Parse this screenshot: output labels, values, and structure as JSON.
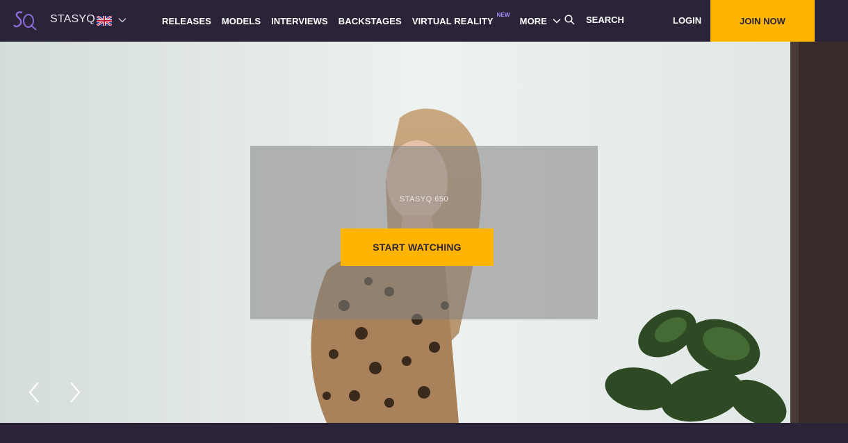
{
  "header": {
    "brand": "STASYQ",
    "nav": {
      "releases": "RELEASES",
      "models": "MODELS",
      "interviews": "INTERVIEWS",
      "backstages": "BACKSTAGES",
      "virtual_reality": "VIRTUAL REALITY",
      "new_badge": "NEW",
      "more": "MORE"
    },
    "search_label": "SEARCH",
    "login_label": "LOGIN",
    "join_label": "JOIN NOW"
  },
  "hero": {
    "slide_title": "STASYQ 650",
    "cta_label": "START WATCHING"
  },
  "icons": {
    "logo": "sq-logo",
    "flag": "uk-flag-icon",
    "search": "search-icon",
    "prev": "chevron-left-icon",
    "next": "chevron-right-icon"
  },
  "colors": {
    "background": "#2b2438",
    "accent": "#ffb400",
    "new_badge": "#a98dff"
  }
}
